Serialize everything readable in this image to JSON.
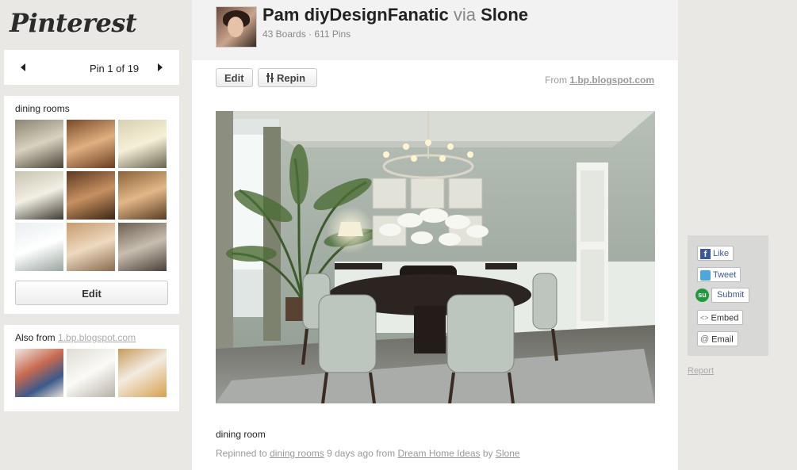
{
  "logo": "Pinterest",
  "pager": {
    "text": "Pin 1 of 19"
  },
  "board": {
    "name": "dining rooms",
    "edit_label": "Edit"
  },
  "also": {
    "prefix": "Also from ",
    "link": "1.bp.blogspot.com"
  },
  "pinner": {
    "name": "Pam diyDesignFanatic",
    "via": "via",
    "via_user": "Slone",
    "stats": "43 Boards · 611 Pins"
  },
  "actions": {
    "edit": "Edit",
    "repin": "Repin"
  },
  "source": {
    "prefix": "From ",
    "link": "1.bp.blogspot.com"
  },
  "pin": {
    "caption": "dining room",
    "repinned_prefix": "Repinned to ",
    "board_link": "dining rooms",
    "time_text": " 9 days ago from ",
    "source_link": "Dream Home Ideas",
    "by_text": " by ",
    "user_link": "Slone"
  },
  "share": {
    "like": "Like",
    "tweet": "Tweet",
    "submit": "Submit",
    "embed": "Embed",
    "email": "Email"
  },
  "report": "Report",
  "colors": {
    "panel": "#e9e8e5",
    "header": "#f2f2f2",
    "share_panel": "#d8d8d6"
  },
  "icons": [
    "chevron-left-icon",
    "chevron-right-icon",
    "repin-icon",
    "facebook-icon",
    "twitter-icon",
    "stumbleupon-icon",
    "embed-icon",
    "email-icon"
  ]
}
